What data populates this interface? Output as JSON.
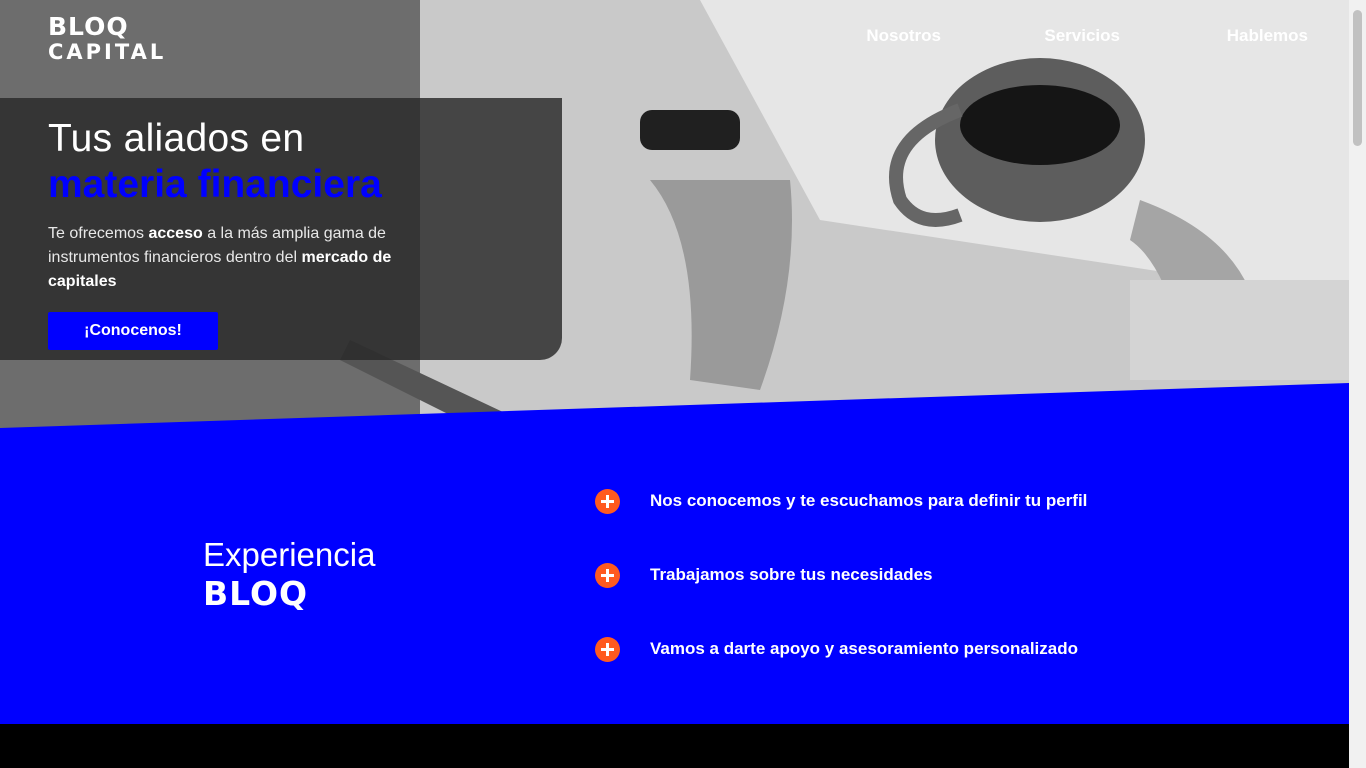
{
  "brand": {
    "line1": "BLOQ",
    "line2": "CAPITAL"
  },
  "nav": {
    "items": [
      "Nosotros",
      "Servicios",
      "Hablemos"
    ]
  },
  "hero": {
    "title_line1": "Tus aliados en",
    "title_line2": "materia financiera",
    "desc_part1": "Te ofrecemos ",
    "desc_bold1": "acceso",
    "desc_part2": " a la más amplia gama de instrumentos financieros dentro del ",
    "desc_bold2": "mercado de capitales",
    "cta_label": "¡Conocenos!"
  },
  "experience": {
    "title": "Experiencia",
    "brand": "BLOQ",
    "steps": [
      "Nos conocemos y te escuchamos para definir tu perfil",
      "Trabajamos sobre tus necesidades",
      "Vamos a darte apoyo y asesoramiento personalizado"
    ]
  },
  "colors": {
    "accent_blue": "#0000ff",
    "accent_orange": "#ff5a1f",
    "card": "#2a2a2a"
  },
  "icons": {
    "step_icon": "plus-circle-icon"
  }
}
